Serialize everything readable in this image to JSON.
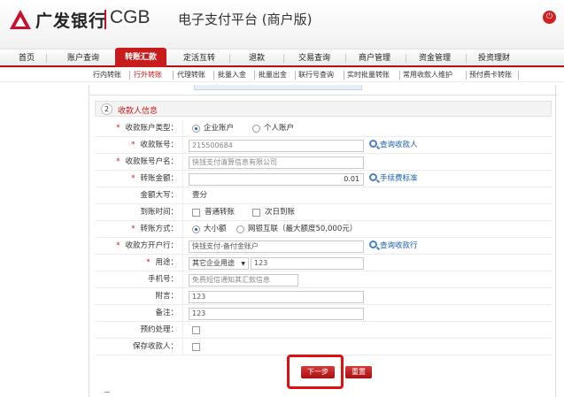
{
  "header": {
    "bank_name": "广发银行",
    "bank_en": "CGB",
    "platform": "电子支付平台 (商户版)",
    "logout_icon": "logout-icon"
  },
  "nav": {
    "items": [
      {
        "label": "首页"
      },
      {
        "label": "账户查询"
      },
      {
        "label": "转账汇款",
        "active": true
      },
      {
        "label": "定活互转"
      },
      {
        "label": "退款"
      },
      {
        "label": "交易查询"
      },
      {
        "label": "商户管理"
      },
      {
        "label": "资金管理"
      },
      {
        "label": "投资理财"
      }
    ]
  },
  "subnav": {
    "items": [
      {
        "label": "行内转账"
      },
      {
        "label": "行外转账",
        "active": true
      },
      {
        "label": "代理转账"
      },
      {
        "label": "批量入金"
      },
      {
        "label": "批量出金"
      },
      {
        "label": "联行号查询"
      },
      {
        "label": "实时批量转账"
      },
      {
        "label": "常用收款人维护"
      },
      {
        "label": "预付费卡转账"
      }
    ]
  },
  "section": {
    "number": "2",
    "title": "收款人信息"
  },
  "form": {
    "account_type_label": "收款账户类型：",
    "account_type_options": [
      "企业账户",
      "个人账户"
    ],
    "account_no_label": "收款账号：",
    "account_no_value": "215500684",
    "query_payee_link": "查询收款人",
    "account_name_label": "收款账号户名：",
    "account_name_value": "快钱支付清算信息有限公司",
    "amount_label": "转账金额：",
    "amount_value": "0.01",
    "fee_link": "手续费标准",
    "amount_upper_label": "金额大写：",
    "amount_upper_value": "壹分",
    "arrival_label": "到账时间：",
    "arrival_options": [
      "普通转账",
      "次日到账"
    ],
    "method_label": "转账方式：",
    "method_options": [
      "大小额",
      "网银互联（最大额度50,000元）"
    ],
    "bank_label": "收款方开户行：",
    "bank_value": "快钱支付-备付金账户",
    "query_bank_link": "查询收款行",
    "purpose_label": "用途：",
    "purpose_select": "其它企业用途",
    "purpose_value": "123",
    "phone_label": "手机号：",
    "phone_placeholder": "免费短信通知其汇款信息",
    "message_label": "附言：",
    "message_value": "123",
    "remark_label": "备注：",
    "remark_value": "123",
    "schedule_label": "预约处理：",
    "save_payee_label": "保存收款人："
  },
  "buttons": {
    "next": "下一步",
    "reset": "重置"
  },
  "colors": {
    "brand_red": "#c81b1b",
    "link_blue": "#1a5fb4"
  }
}
